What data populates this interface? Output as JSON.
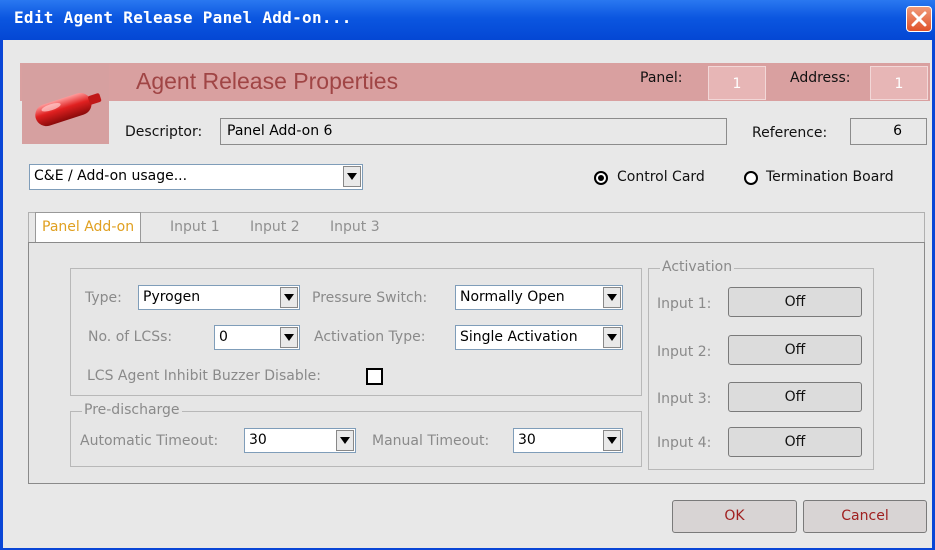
{
  "window": {
    "title": "Edit Agent Release Panel Add-on..."
  },
  "header": {
    "title": "Agent Release Properties",
    "panel_label": "Panel:",
    "panel_value": "1",
    "address_label": "Address:",
    "address_value": "1",
    "descriptor_label": "Descriptor:",
    "descriptor_value": "Panel Add-on 6",
    "reference_label": "Reference:",
    "reference_value": "6"
  },
  "usage_combo": {
    "value": "C&E / Add-on usage..."
  },
  "mode": {
    "options": [
      {
        "label": "Control Card",
        "selected": true
      },
      {
        "label": "Termination Board",
        "selected": false
      }
    ]
  },
  "tabs": [
    {
      "label": "Panel Add-on",
      "active": true
    },
    {
      "label": "Input 1",
      "active": false
    },
    {
      "label": "Input 2",
      "active": false
    },
    {
      "label": "Input 3",
      "active": false
    }
  ],
  "properties": {
    "type_label": "Type:",
    "type_value": "Pyrogen",
    "pressure_label": "Pressure Switch:",
    "pressure_value": "Normally Open",
    "lcs_label": "No. of LCSs:",
    "lcs_value": "0",
    "activation_type_label": "Activation Type:",
    "activation_type_value": "Single Activation",
    "inhibit_label": "LCS Agent Inhibit Buzzer Disable:",
    "inhibit_checked": false
  },
  "predischarge": {
    "title": "Pre-discharge",
    "auto_label": "Automatic Timeout:",
    "auto_value": "30",
    "manual_label": "Manual Timeout:",
    "manual_value": "30"
  },
  "activation": {
    "title": "Activation",
    "inputs": [
      {
        "label": "Input 1:",
        "value": "Off"
      },
      {
        "label": "Input 2:",
        "value": "Off"
      },
      {
        "label": "Input 3:",
        "value": "Off"
      },
      {
        "label": "Input 4:",
        "value": "Off"
      }
    ]
  },
  "buttons": {
    "ok": "OK",
    "cancel": "Cancel"
  },
  "colors": {
    "title_bar": "#0b56e0",
    "header_band": "#d9a0a0",
    "header_title": "#a04545",
    "active_tab": "#e0a020"
  },
  "icons": {
    "logo": "gas-canister-icon",
    "close": "close-icon",
    "dropdown": "chevron-down-icon"
  }
}
